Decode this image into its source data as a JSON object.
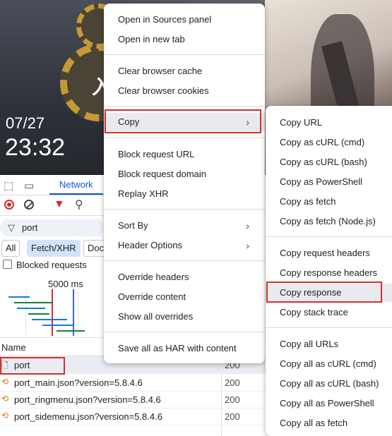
{
  "background": {
    "date": "07/27",
    "time": "23:32",
    "ink_text": "入渠"
  },
  "devtools": {
    "tab_network": "Network",
    "filter_value": "port",
    "chips": {
      "all": "All",
      "fetch_xhr": "Fetch/XHR",
      "doc": "Doc"
    },
    "blocked_requests": "Blocked requests",
    "timeline_label": "5000 ms",
    "column_name": "Name",
    "rows": [
      {
        "icon": "document-icon",
        "name": "port",
        "status": "200"
      },
      {
        "icon": "xhr-icon",
        "name": "port_main.json?version=5.8.4.6",
        "status": "200"
      },
      {
        "icon": "xhr-icon",
        "name": "port_ringmenu.json?version=5.8.4.6",
        "status": "200"
      },
      {
        "icon": "xhr-icon",
        "name": "port_sidemenu.json?version=5.8.4.6",
        "status": "200"
      }
    ]
  },
  "context_menu": {
    "items": [
      {
        "label": "Open in Sources panel"
      },
      {
        "label": "Open in new tab"
      },
      {
        "label": "Clear browser cache"
      },
      {
        "label": "Clear browser cookies"
      },
      {
        "label": "Copy",
        "submenu": true
      },
      {
        "label": "Block request URL"
      },
      {
        "label": "Block request domain"
      },
      {
        "label": "Replay XHR"
      },
      {
        "label": "Sort By",
        "submenu": true
      },
      {
        "label": "Header Options",
        "submenu": true
      },
      {
        "label": "Override headers"
      },
      {
        "label": "Override content"
      },
      {
        "label": "Show all overrides"
      },
      {
        "label": "Save all as HAR with content"
      }
    ]
  },
  "copy_submenu": {
    "items": [
      {
        "label": "Copy URL"
      },
      {
        "label": "Copy as cURL (cmd)"
      },
      {
        "label": "Copy as cURL (bash)"
      },
      {
        "label": "Copy as PowerShell"
      },
      {
        "label": "Copy as fetch"
      },
      {
        "label": "Copy as fetch (Node.js)"
      },
      {
        "label": "Copy request headers"
      },
      {
        "label": "Copy response headers"
      },
      {
        "label": "Copy response"
      },
      {
        "label": "Copy stack trace"
      },
      {
        "label": "Copy all URLs"
      },
      {
        "label": "Copy all as cURL (cmd)"
      },
      {
        "label": "Copy all as cURL (bash)"
      },
      {
        "label": "Copy all as PowerShell"
      },
      {
        "label": "Copy all as fetch"
      }
    ]
  },
  "colors": {
    "accent": "#0b57d0",
    "highlight_box": "#d32f2f",
    "menu_hover": "#e8eaee"
  }
}
